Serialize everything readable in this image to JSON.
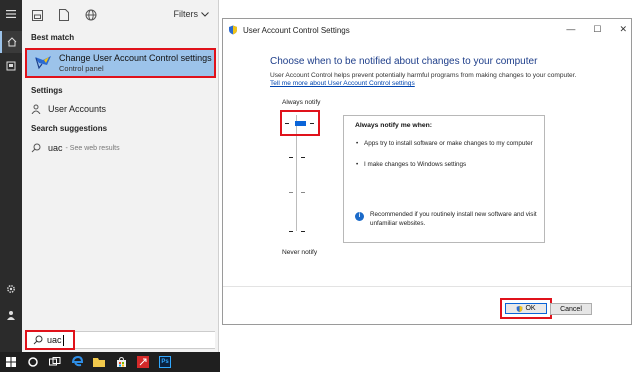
{
  "start_menu": {
    "rail": {
      "icons": [
        "hamburger-menu-icon",
        "home-icon",
        "documents-icon",
        "settings-gear-icon",
        "user-icon",
        "windows-logo-icon"
      ]
    },
    "top_icons": [
      "apps-icon",
      "documents-icon",
      "web-globe-icon"
    ],
    "filters_label": "Filters",
    "best_match": {
      "section_label": "Best match",
      "title": "Change User Account Control settings",
      "subtitle": "Control panel"
    },
    "settings": {
      "section_label": "Settings",
      "item_label": "User Accounts"
    },
    "suggestions": {
      "section_label": "Search suggestions",
      "query": "uac",
      "hint": "- See web results"
    },
    "search": {
      "value": "uac"
    }
  },
  "taskbar": {
    "icons": [
      "windows-start-icon",
      "cortana-circle-icon",
      "task-view-icon",
      "edge-browser-icon",
      "file-explorer-icon",
      "store-icon",
      "red-app-icon",
      "photoshop-icon"
    ],
    "photoshop_label": "Ps"
  },
  "uac_window": {
    "title": "User Account Control Settings",
    "controls": {
      "minimize": "—",
      "maximize": "☐",
      "close": "✕"
    },
    "heading": "Choose when to be notified about changes to your computer",
    "description": "User Account Control helps prevent potentially harmful programs from making changes to your computer.",
    "link": "Tell me more about User Account Control settings",
    "slider": {
      "top_label": "Always notify",
      "bottom_label": "Never notify",
      "levels": 4,
      "selected_level": 4
    },
    "info": {
      "title": "Always notify me when:",
      "bullets": [
        "Apps try to install software or make changes to my computer",
        "I make changes to Windows settings"
      ],
      "recommendation": "Recommended if you routinely install new software and visit unfamiliar websites."
    },
    "buttons": {
      "ok": "OK",
      "cancel": "Cancel"
    }
  },
  "colors": {
    "highlight_red": "#e0121b",
    "selected_blue": "#9cc3ea",
    "accent_blue": "#0a64d8",
    "heading_blue": "#1e3e8a"
  }
}
